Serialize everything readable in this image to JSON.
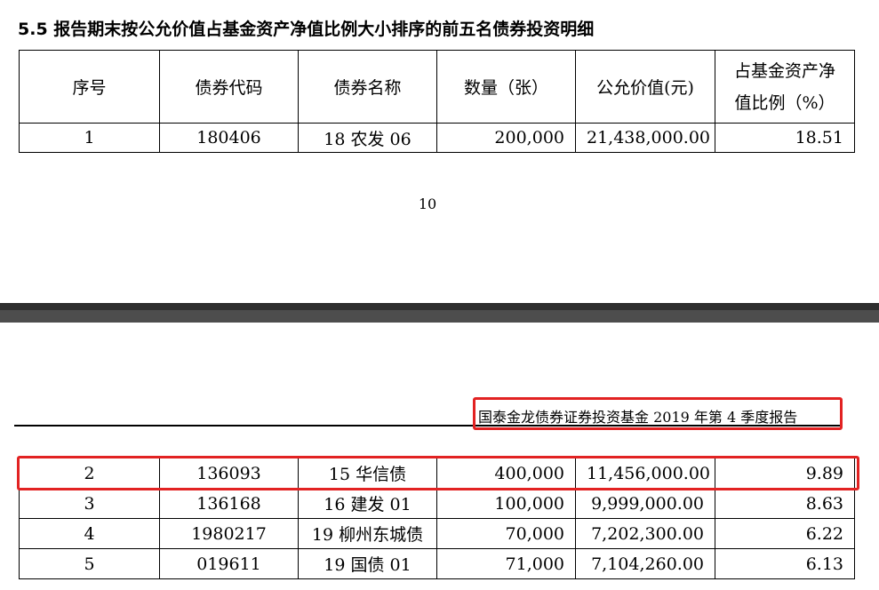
{
  "section_title": "5.5 报告期末按公允价值占基金资产净值比例大小排序的前五名债券投资明细",
  "columns": [
    "序号",
    "债券代码",
    "债券名称",
    "数量（张）",
    "公允价值(元)",
    "占基金资产净值比例（%）"
  ],
  "page_number": "10",
  "report_header": "国泰金龙债券证券投资基金 2019 年第 4 季度报告",
  "rows_page1": [
    [
      "1",
      "180406",
      "18 农发 06",
      "200,000",
      "21,438,000.00",
      "18.51"
    ]
  ],
  "rows_page2": [
    [
      "2",
      "136093",
      "15 华信债",
      "400,000",
      "11,456,000.00",
      "9.89"
    ],
    [
      "3",
      "136168",
      "16 建发 01",
      "100,000",
      "9,999,000.00",
      "8.63"
    ],
    [
      "4",
      "1980217",
      "19 柳州东城债",
      "70,000",
      "7,202,300.00",
      "6.22"
    ],
    [
      "5",
      "019611",
      "19 国债 01",
      "71,000",
      "7,104,260.00",
      "6.13"
    ]
  ],
  "highlight_color": "#e22222"
}
